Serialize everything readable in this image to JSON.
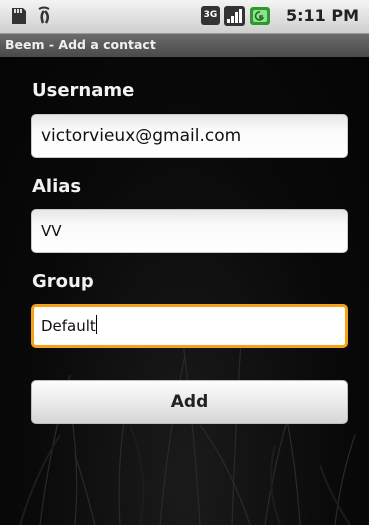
{
  "status_bar": {
    "time": "5:11 PM",
    "network_type": "3G",
    "icons": [
      "sd-card-icon",
      "usb-icon",
      "3g-icon",
      "signal-icon",
      "battery-icon"
    ]
  },
  "title_bar": {
    "title": "Beem - Add a contact"
  },
  "form": {
    "username": {
      "label": "Username",
      "value": "victorvieux@gmail.com"
    },
    "alias": {
      "label": "Alias",
      "value": "VV"
    },
    "group": {
      "label": "Group",
      "value": "Default"
    },
    "add_button_label": "Add"
  },
  "colors": {
    "focus_border": "#f3a21a",
    "title_bar": "#5a5a5a",
    "background": "#050505"
  }
}
